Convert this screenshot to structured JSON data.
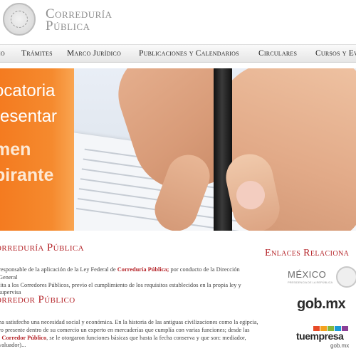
{
  "header": {
    "brand_line1": "Correduría",
    "brand_line2": "Pública"
  },
  "nav": {
    "items": [
      {
        "label": "io"
      },
      {
        "label": "Trámites"
      },
      {
        "label": "Marco Jurídico"
      },
      {
        "label": "Publicaciones y Calendarios"
      },
      {
        "label": "Circulares"
      },
      {
        "label": "Cursos y Ev"
      }
    ]
  },
  "banner": {
    "line1": "ocatoria",
    "line2": "resentar",
    "line3": "men",
    "line4": "pirante",
    "colors": {
      "panel": "#f47b20"
    }
  },
  "main": {
    "section1": {
      "heading": "orreduría Pública",
      "text_a": "responsable de la aplicación de la Ley Federal de ",
      "text_b": "Correduría Pública;",
      "text_c": " por conducto de la Dirección General",
      "text_d": "lita a los Corredores Públicos, previo el cumplimiento de los requisitos establecidos en la propia ley y supervisa"
    },
    "section2": {
      "heading": "orredor Público",
      "text_a": "na satisfecho una necesidad social y económica. En la historia de las antiguas civilizaciones como la egipcia,",
      "text_b": "ro presente dentro de su comercio un experto en mercaderías que cumplía con varias funciones; desde las",
      "text_c": "l ",
      "text_d": "Corredor Público",
      "text_e": ", se le otorgaron funciones básicas que hasta la fecha conserva y que son: mediador,",
      "text_f": "valuador)..."
    }
  },
  "sidebar": {
    "heading": "Enlaces Relaciona",
    "mexico_label": "MÉXICO",
    "mexico_sub": "PRESIDENCIA DE LA REPÚBLICA",
    "gobmx_label": "gob.mx",
    "tuempresa_label": "tuempresa",
    "tuempresa_sub": "gob.mx",
    "accent_color": "#b5252a"
  }
}
